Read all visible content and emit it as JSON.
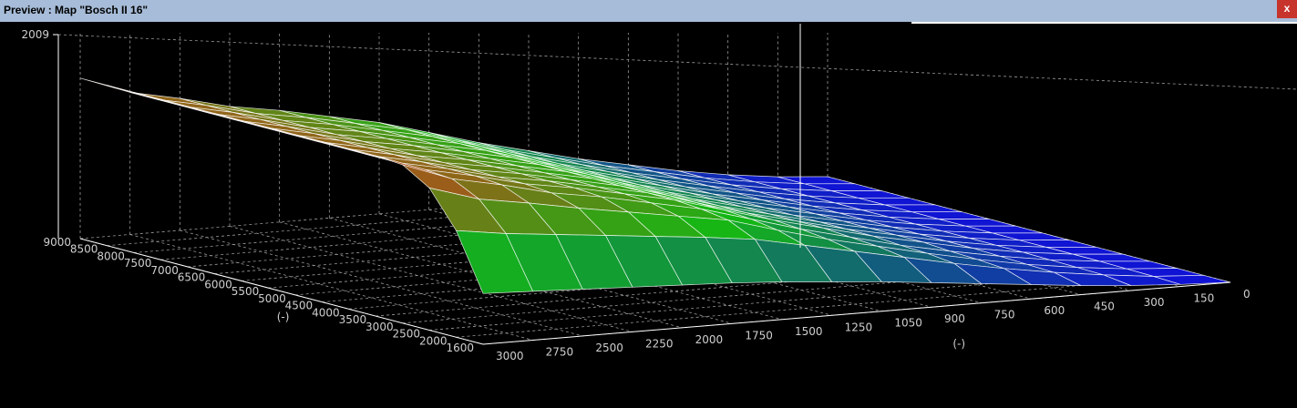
{
  "window": {
    "title": "Preview : Map \"Bosch II 16\"",
    "close_glyph": "x"
  },
  "colors": {
    "titlebar": "#a6bcd8",
    "close": "#c7342b",
    "background": "#000000",
    "axes": "#ffffff",
    "grid": "#9a9a9a",
    "surface_high": "#c8401c",
    "surface_mid": "#14b814",
    "surface_low": "#1010d8"
  },
  "chart_data": {
    "type": "surface",
    "title": "",
    "z_axis": {
      "ticks": [
        "2009"
      ],
      "range": [
        0,
        2009
      ]
    },
    "x_axis": {
      "label": "(-)",
      "ticks": [
        "3000",
        "2750",
        "2500",
        "2250",
        "2000",
        "1750",
        "1500",
        "1250",
        "1050",
        "900",
        "750",
        "600",
        "450",
        "300",
        "150",
        "0"
      ],
      "values": [
        3000,
        2750,
        2500,
        2250,
        2000,
        1750,
        1500,
        1250,
        1050,
        900,
        750,
        600,
        450,
        300,
        150,
        0
      ]
    },
    "y_axis": {
      "label": "(-)",
      "ticks": [
        "9000",
        "8500",
        "8000",
        "7500",
        "7000",
        "6500",
        "6000",
        "5500",
        "5000",
        "4500",
        "4000",
        "3500",
        "3000",
        "2500",
        "2000",
        "1600"
      ],
      "values": [
        9000,
        8500,
        8000,
        7500,
        7000,
        6500,
        6000,
        5500,
        5000,
        4500,
        4000,
        3500,
        3000,
        2500,
        2000,
        1600
      ]
    },
    "z_values_approx": [
      [
        1580,
        1400,
        1300,
        1180,
        1100,
        1000,
        900,
        760,
        620,
        500,
        380,
        280,
        180,
        100,
        40,
        0
      ],
      [
        1580,
        1400,
        1300,
        1180,
        1100,
        1000,
        900,
        760,
        620,
        500,
        380,
        280,
        180,
        100,
        40,
        0
      ],
      [
        1580,
        1400,
        1300,
        1180,
        1100,
        1000,
        900,
        760,
        620,
        500,
        380,
        280,
        180,
        100,
        40,
        0
      ],
      [
        1580,
        1400,
        1300,
        1180,
        1100,
        1000,
        900,
        760,
        620,
        500,
        380,
        280,
        180,
        100,
        40,
        0
      ],
      [
        1580,
        1400,
        1300,
        1180,
        1100,
        1000,
        900,
        760,
        620,
        500,
        380,
        280,
        180,
        100,
        40,
        0
      ],
      [
        1580,
        1400,
        1300,
        1180,
        1100,
        1000,
        900,
        760,
        620,
        500,
        380,
        280,
        180,
        100,
        40,
        0
      ],
      [
        1580,
        1400,
        1300,
        1180,
        1100,
        1000,
        900,
        760,
        620,
        500,
        380,
        280,
        180,
        100,
        40,
        0
      ],
      [
        1580,
        1400,
        1300,
        1180,
        1100,
        1000,
        900,
        760,
        620,
        500,
        380,
        280,
        180,
        100,
        40,
        0
      ],
      [
        1580,
        1400,
        1300,
        1180,
        1100,
        1000,
        900,
        760,
        620,
        500,
        380,
        280,
        180,
        100,
        40,
        0
      ],
      [
        1580,
        1400,
        1300,
        1180,
        1100,
        1000,
        900,
        760,
        620,
        500,
        380,
        280,
        180,
        100,
        40,
        0
      ],
      [
        1580,
        1400,
        1300,
        1180,
        1100,
        1000,
        900,
        760,
        620,
        500,
        380,
        280,
        180,
        100,
        40,
        0
      ],
      [
        1580,
        1400,
        1300,
        1180,
        1100,
        1000,
        900,
        760,
        620,
        500,
        380,
        280,
        180,
        100,
        40,
        0
      ],
      [
        1560,
        1380,
        1280,
        1160,
        1080,
        980,
        880,
        740,
        600,
        480,
        360,
        260,
        170,
        95,
        40,
        0
      ],
      [
        1400,
        1250,
        1170,
        1080,
        1000,
        920,
        840,
        700,
        570,
        460,
        350,
        250,
        160,
        90,
        35,
        0
      ],
      [
        1050,
        980,
        930,
        880,
        830,
        780,
        720,
        620,
        520,
        420,
        320,
        230,
        150,
        85,
        30,
        0
      ],
      [
        500,
        480,
        460,
        440,
        420,
        400,
        370,
        330,
        290,
        240,
        190,
        140,
        90,
        50,
        20,
        0
      ]
    ],
    "grid": true,
    "legend": "none"
  }
}
